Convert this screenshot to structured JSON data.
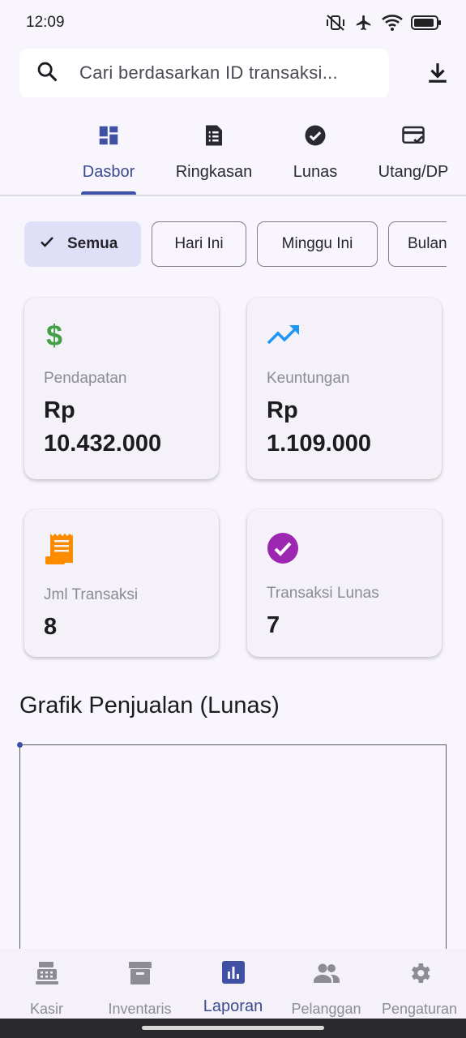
{
  "status_bar": {
    "time": "12:09",
    "icons": [
      "mute-vibrate-icon",
      "airplane-icon",
      "wifi-icon",
      "battery-icon"
    ]
  },
  "search": {
    "placeholder": "Cari berdasarkan ID transaksi...",
    "value": "",
    "icon": "search-icon",
    "action_icon": "download-icon"
  },
  "tabs": [
    {
      "label": "Dasbor",
      "icon": "dashboard-icon",
      "active": true
    },
    {
      "label": "Ringkasan",
      "icon": "summary-icon",
      "active": false
    },
    {
      "label": "Lunas",
      "icon": "check-circle-icon",
      "active": false
    },
    {
      "label": "Utang/DP",
      "icon": "card-check-icon",
      "active": false
    }
  ],
  "filters": [
    {
      "label": "Semua",
      "selected": true
    },
    {
      "label": "Hari Ini",
      "selected": false
    },
    {
      "label": "Minggu Ini",
      "selected": false
    },
    {
      "label": "Bulan Ini",
      "selected": false
    }
  ],
  "stats": [
    {
      "label": "Pendapatan",
      "value_line1": "Rp",
      "value_line2": "10.432.000",
      "icon": "dollar-icon",
      "color": "#43a047"
    },
    {
      "label": "Keuntungan",
      "value_line1": "Rp",
      "value_line2": "1.109.000",
      "icon": "trending-up-icon",
      "color": "#2196f3"
    },
    {
      "label": "Jml Transaksi",
      "value_line1": "8",
      "icon": "receipt-icon",
      "color": "#fb8c00"
    },
    {
      "label": "Transaksi Lunas",
      "value_line1": "7",
      "icon": "check-circle-icon",
      "color": "#9c27b0"
    }
  ],
  "chart": {
    "title": "Grafik Penjualan (Lunas)"
  },
  "bottom_nav": [
    {
      "label": "Kasir",
      "icon": "cash-register-icon",
      "active": false
    },
    {
      "label": "Inventaris",
      "icon": "archive-icon",
      "active": false
    },
    {
      "label": "Laporan",
      "icon": "bar-chart-icon",
      "active": true
    },
    {
      "label": "Pelanggan",
      "icon": "people-icon",
      "active": false
    },
    {
      "label": "Pengaturan",
      "icon": "gear-icon",
      "active": false
    }
  ],
  "colors": {
    "accent": "#3f51a5",
    "background": "#f8f6fc",
    "chip_selected": "#dfe0f7"
  }
}
